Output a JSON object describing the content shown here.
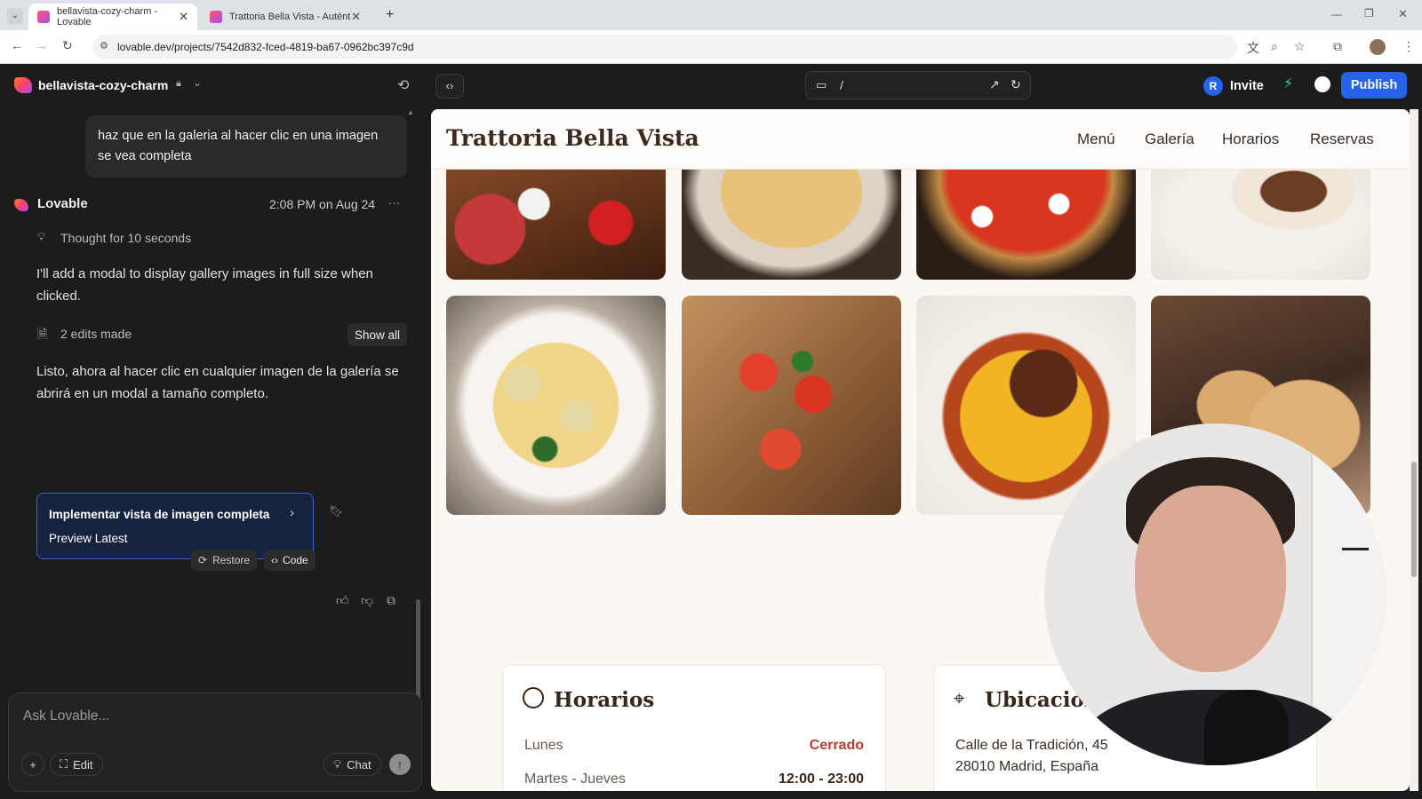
{
  "browser": {
    "tabs": [
      {
        "title": "bellavista-cozy-charm - Lovable",
        "close": "✕"
      },
      {
        "title": "Trattoria Bella Vista - Auténtica",
        "close": "✕"
      }
    ],
    "new_tab": "+",
    "url": "lovable.dev/projects/7542d832-fced-4819-ba67-0962bc397c9d"
  },
  "project": {
    "name": "bellavista-cozy-charm"
  },
  "chat": {
    "user_message": "haz que en la galeria al hacer clic en una imagen se vea completa",
    "assistant_name": "Lovable",
    "timestamp": "2:08 PM on Aug 24",
    "more": "···",
    "thought": "Thought for 10 seconds",
    "reply1": "I'll add a modal to display gallery images in full size when clicked.",
    "edits": "2 edits made",
    "show_all": "Show all",
    "reply2": "Listo, ahora al hacer clic en cualquier imagen de la galería se abrirá en un modal a tamaño completo.",
    "artifact_title": "Implementar vista de imagen completa",
    "artifact_sub": "Preview Latest",
    "restore": "Restore",
    "code": "Code"
  },
  "composer": {
    "placeholder": "Ask Lovable...",
    "plus": "+",
    "edit": "Edit",
    "chat": "Chat"
  },
  "toolbar": {
    "route": "/",
    "invite_initial": "R",
    "invite": "Invite",
    "publish": "Publish"
  },
  "site": {
    "brand": "Trattoria Bella Vista",
    "nav": [
      "Menú",
      "Galería",
      "Horarios",
      "Reservas"
    ],
    "hours": {
      "title": "Horarios",
      "row1_day": "Lunes",
      "row1_value": "Cerrado",
      "row2_day": "Martes - Jueves",
      "row2_value": "12:00 - 23:00"
    },
    "location": {
      "title": "Ubicación",
      "line1": "Calle de la Tradición, 45",
      "line2": "28010 Madrid, España"
    }
  },
  "colors": {
    "accent": "#2563eb",
    "closed": "#c0392b",
    "brand_text": "#3d2a1c"
  }
}
